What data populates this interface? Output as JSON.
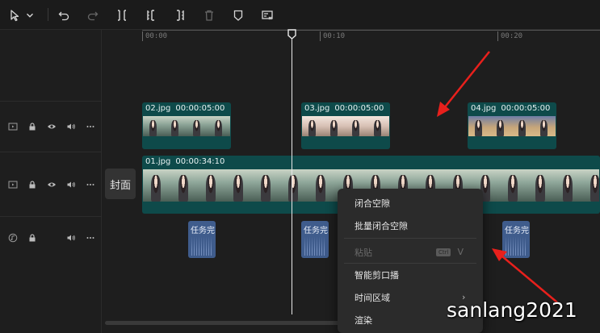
{
  "toolbar": {
    "tools": [
      {
        "icon": "select-cursor-icon"
      },
      {
        "icon": "dropdown-chevron-icon"
      },
      {
        "icon": "undo-icon"
      },
      {
        "icon": "redo-icon"
      },
      {
        "icon": "split-icon"
      },
      {
        "icon": "trim-left-icon"
      },
      {
        "icon": "trim-right-icon"
      },
      {
        "icon": "delete-icon"
      },
      {
        "icon": "marker-icon"
      },
      {
        "icon": "auto-caption-icon"
      }
    ]
  },
  "ruler": {
    "ticks": [
      "00:00",
      "00:10",
      "00:20"
    ]
  },
  "cover": {
    "label": "封面"
  },
  "tracks": {
    "overlay": {
      "clips": [
        {
          "name": "02.jpg",
          "duration": "00:00:05:00"
        },
        {
          "name": "03.jpg",
          "duration": "00:00:05:00"
        },
        {
          "name": "04.jpg",
          "duration": "00:00:05:00"
        }
      ]
    },
    "main": {
      "clips": [
        {
          "name": "01.jpg",
          "duration": "00:00:34:10"
        }
      ]
    },
    "audio": {
      "clips": [
        {
          "label": "任务完"
        },
        {
          "label": "任务完"
        },
        {
          "label": "任务完"
        }
      ]
    }
  },
  "context_menu": {
    "items": [
      {
        "label": "闭合空隙",
        "enabled": true
      },
      {
        "label": "批量闭合空隙",
        "enabled": true
      },
      {
        "label": "粘贴",
        "enabled": false,
        "shortcut_mod": "Ctrl",
        "shortcut_key": "V"
      },
      {
        "label": "智能剪口播",
        "enabled": true
      },
      {
        "label": "时间区域",
        "enabled": true,
        "submenu": true,
        "chevron": "›"
      },
      {
        "label": "渲染",
        "enabled": true
      }
    ]
  },
  "watermark": "sanlang2021",
  "colors": {
    "video_clip": "#0e4a4a",
    "audio_clip": "#3f5c8c",
    "annotation_arrow": "#e8201c"
  }
}
